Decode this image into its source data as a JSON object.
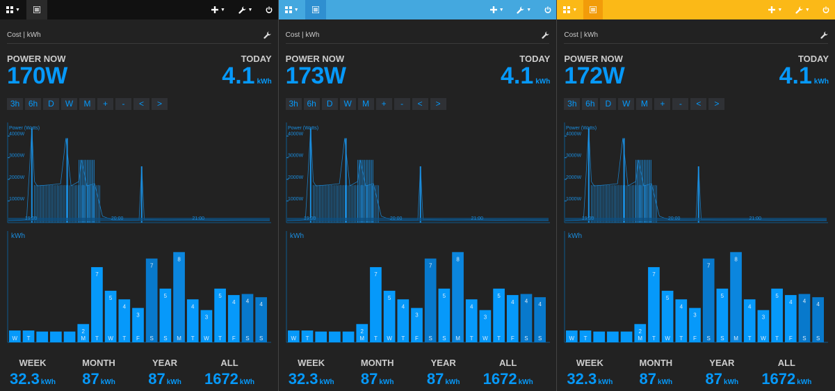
{
  "panels": [
    {
      "id": "a",
      "theme": {
        "topbar": "#111111",
        "active_btn": "#2a2a2a",
        "active_width": 30
      },
      "power_now": "170W"
    },
    {
      "id": "b",
      "theme": {
        "topbar": "#44a8df",
        "active_btn": "#2f8fd0",
        "active_width": 30
      },
      "power_now": "173W"
    },
    {
      "id": "c",
      "theme": {
        "topbar": "#fbb917",
        "active_btn": "#f29c0a",
        "active_width": 28
      },
      "power_now": "172W"
    }
  ],
  "common": {
    "title": "Cost | kWh",
    "power_now_label": "POWER NOW",
    "today_label": "TODAY",
    "today_value": "4.1",
    "today_unit": "kWh",
    "controls": [
      "3h",
      "6h",
      "D",
      "W",
      "M",
      "+",
      "-",
      "<",
      ">"
    ],
    "stats": [
      {
        "label": "WEEK",
        "value": "32.3",
        "unit": "kWh"
      },
      {
        "label": "MONTH",
        "value": "87",
        "unit": "kWh"
      },
      {
        "label": "YEAR",
        "value": "87",
        "unit": "kWh"
      },
      {
        "label": "ALL",
        "value": "1672",
        "unit": "kWh"
      }
    ],
    "icons": {
      "dashboard": "grid-icon",
      "list": "list-icon",
      "add": "plus-icon",
      "tools": "wrench-icon",
      "power": "power-icon"
    }
  },
  "chart_data": [
    {
      "type": "line",
      "ylabel": "Power (Watts)",
      "y_ticks": [
        "4000W",
        "3000W",
        "2000W",
        "1000W"
      ],
      "x_ticks": [
        "19:00",
        "20:00",
        "21:00"
      ],
      "ylim": [
        0,
        4500
      ],
      "series": [
        {
          "points": [
            [
              0,
              80
            ],
            [
              0.05,
              120
            ],
            [
              0.07,
              150
            ],
            [
              0.09,
              4350
            ],
            [
              0.1,
              1900
            ],
            [
              0.11,
              1700
            ],
            [
              0.16,
              1750
            ],
            [
              0.2,
              1800
            ],
            [
              0.22,
              3900
            ],
            [
              0.24,
              1700
            ],
            [
              0.27,
              1900
            ],
            [
              0.28,
              2900
            ],
            [
              0.3,
              1700
            ],
            [
              0.33,
              1800
            ],
            [
              0.36,
              300
            ],
            [
              0.4,
              120
            ],
            [
              0.5,
              130
            ],
            [
              0.51,
              2600
            ],
            [
              0.52,
              150
            ],
            [
              0.6,
              130
            ],
            [
              0.7,
              140
            ],
            [
              0.8,
              120
            ],
            [
              0.9,
              130
            ],
            [
              1,
              120
            ]
          ]
        }
      ]
    },
    {
      "type": "bar",
      "ylabel": "kWh",
      "categories": [
        "W",
        "T",
        "",
        "",
        "",
        "M",
        "T",
        "W",
        "T",
        "F",
        "S",
        "S",
        "M",
        "T",
        "W",
        "T",
        "F",
        "S",
        "S"
      ],
      "values": [
        1.1,
        1.1,
        1.0,
        1.0,
        1.0,
        1.7,
        7.0,
        4.8,
        4.0,
        3.2,
        7.8,
        5.0,
        8.4,
        4.0,
        3.0,
        5.0,
        4.4,
        4.5,
        4.2
      ],
      "labels": [
        "",
        "",
        "",
        "",
        "",
        "2",
        "7",
        "5",
        "4",
        "3",
        "7",
        "5",
        "8",
        "4",
        "3",
        "5",
        "4",
        "4",
        "4"
      ]
    }
  ]
}
